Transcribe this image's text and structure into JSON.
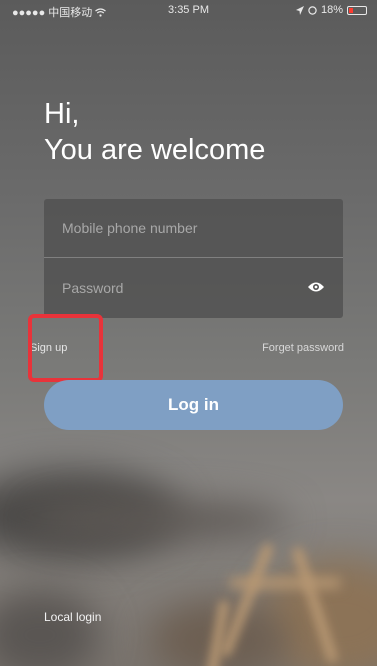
{
  "status_bar": {
    "carrier": "●●●●● 中国移动",
    "time": "3:35 PM",
    "battery": "18%"
  },
  "greeting": {
    "line1": "Hi,",
    "line2": "You are welcome"
  },
  "form": {
    "phone_placeholder": "Mobile phone number",
    "password_placeholder": "Password"
  },
  "links": {
    "sign_up": "Sign up",
    "forgot_password": "Forget password"
  },
  "login_button": "Log in",
  "local_login": "Local login",
  "colors": {
    "login_button": "#7f9fc4",
    "highlight": "#e8333a"
  },
  "icons": [
    "wifi-icon",
    "location-icon",
    "alarm-icon",
    "battery-icon",
    "eye-icon"
  ]
}
